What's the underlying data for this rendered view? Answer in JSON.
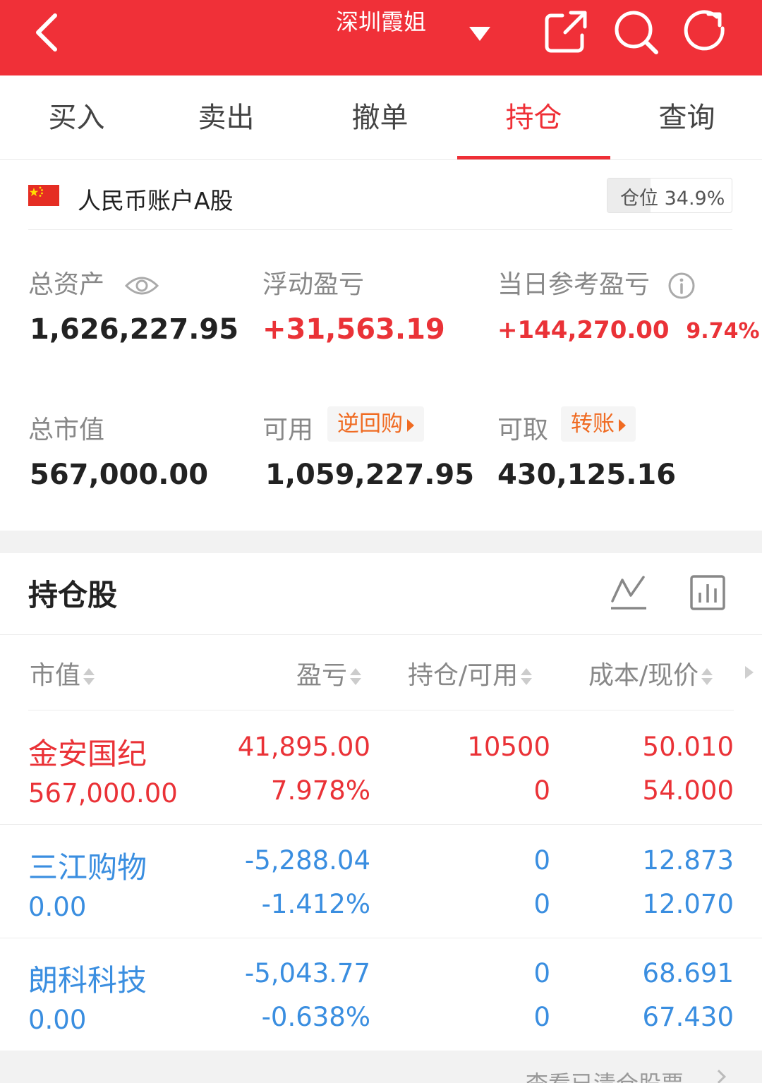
{
  "header": {
    "title": "深圳霞姐",
    "back_icon": "back-arrow-icon",
    "dropdown_icon": "triangle-down-icon",
    "share_icon": "share-external-icon",
    "search_icon": "search-icon",
    "refresh_icon": "refresh-icon",
    "color": "#f03038"
  },
  "tabs": [
    {
      "label": "买入",
      "active": false
    },
    {
      "label": "卖出",
      "active": false
    },
    {
      "label": "撤单",
      "active": false
    },
    {
      "label": "持仓",
      "active": true
    },
    {
      "label": "查询",
      "active": false
    }
  ],
  "account": {
    "flag_icon": "china-flag-icon",
    "name": "人民币账户A股",
    "position_label": "仓位",
    "position_value": "34.9%",
    "position_fraction": 0.349
  },
  "summary": {
    "total_assets_label": "总资产",
    "total_assets": "1,626,227.95",
    "floating_pl_label": "浮动盈亏",
    "floating_pl": "+31,563.19",
    "daily_pl_label": "当日参考盈亏",
    "daily_pl": "+144,270.00",
    "daily_pl_pct": "9.74%",
    "market_value_label": "总市值",
    "market_value": "567,000.00",
    "available_label": "可用",
    "available_chip": "逆回购",
    "available": "1,059,227.95",
    "withdrawable_label": "可取",
    "withdrawable_chip": "转账",
    "withdrawable": "430,125.16"
  },
  "holdings": {
    "title": "持仓股",
    "columns": [
      "市值",
      "盈亏",
      "持仓/可用",
      "成本/现价"
    ],
    "rows": [
      {
        "name": "金安国纪",
        "market_value": "567,000.00",
        "pl": "41,895.00",
        "pl_pct": "7.978%",
        "holding": "10500",
        "available": "0",
        "cost": "50.010",
        "price": "54.000",
        "trend": "up"
      },
      {
        "name": "三江购物",
        "market_value": "0.00",
        "pl": "-5,288.04",
        "pl_pct": "-1.412%",
        "holding": "0",
        "available": "0",
        "cost": "12.873",
        "price": "12.070",
        "trend": "down"
      },
      {
        "name": "朗科科技",
        "market_value": "0.00",
        "pl": "-5,043.77",
        "pl_pct": "-0.638%",
        "holding": "0",
        "available": "0",
        "cost": "68.691",
        "price": "67.430",
        "trend": "down"
      }
    ]
  },
  "footer": {
    "link": "查看已清仓股票"
  }
}
